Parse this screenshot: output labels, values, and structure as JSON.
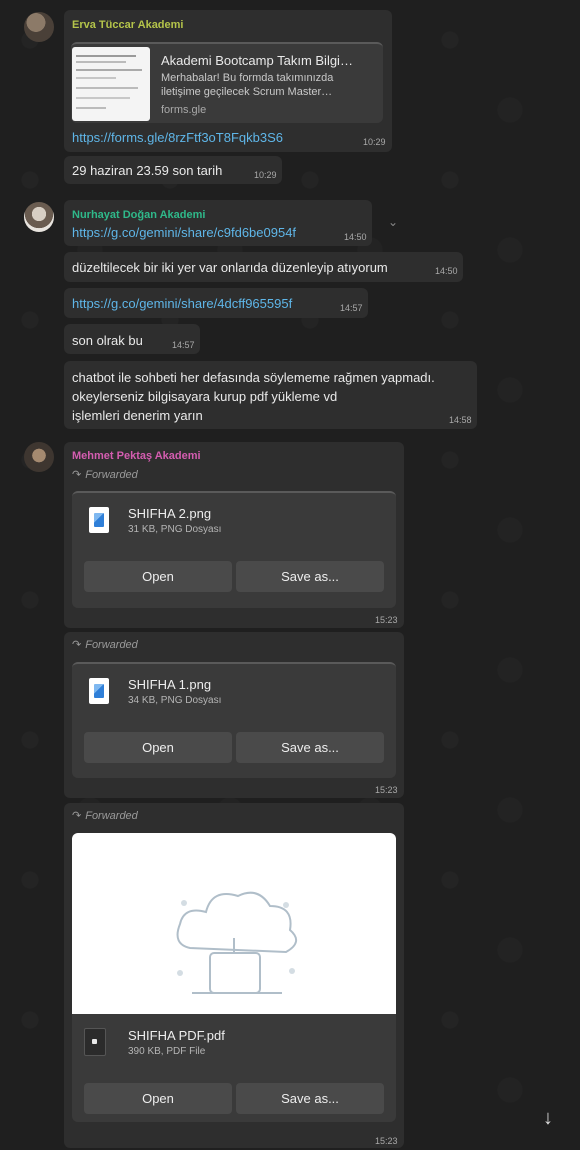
{
  "chat": {
    "group1": {
      "sender": "Erva Tüccar Akademi",
      "sender_color": "#b4c44a",
      "link_preview": {
        "title": "Akademi Bootcamp Takım Bilgi…",
        "desc_line1": "Merhabalar! Bu formda takımınızda",
        "desc_line2": "iletişime geçilecek Scrum Master…",
        "domain": "forms.gle"
      },
      "link": "https://forms.gle/8rzFtf3oT8Fqkb3S6",
      "time1": "10:29",
      "msg2": "29 haziran 23.59 son tarih",
      "time2": "10:29"
    },
    "group2": {
      "sender": "Nurhayat Doğan Akademi",
      "sender_color": "#2fb98a",
      "link1": "https://g.co/gemini/share/c9fd6be0954f",
      "time1": "14:50",
      "msg2": "düzeltilecek bir iki yer var onlarıda düzenleyip atıyorum",
      "time2": "14:50",
      "link3": "https://g.co/gemini/share/4dcff965595f",
      "time3": "14:57",
      "msg4": "son olrak bu",
      "time4": "14:57",
      "msg5_line1": "chatbot ile sohbeti her defasında söylememe rağmen yapmadı.",
      "msg5_line2": "okeylerseniz bilgisayara kurup pdf yükleme vd",
      "msg5_line3": "işlemleri denerim yarın",
      "time5": "14:58"
    },
    "group3": {
      "sender": "Mehmet Pektaş Akademi",
      "sender_color": "#d45db0",
      "forwarded_label": "Forwarded",
      "files": [
        {
          "name": "SHIFHA 2.png",
          "meta": "31 KB, PNG Dosyası",
          "open": "Open",
          "save": "Save as...",
          "time": "15:23"
        },
        {
          "name": "SHIFHA 1.png",
          "meta": "34 KB, PNG Dosyası",
          "open": "Open",
          "save": "Save as...",
          "time": "15:23"
        },
        {
          "name": "SHIFHA PDF.pdf",
          "meta": "390 KB, PDF File",
          "open": "Open",
          "save": "Save as...",
          "time": "15:23"
        }
      ]
    }
  },
  "icons": {
    "forward": "↷",
    "scroll_down": "↓",
    "chevron": "⌄"
  }
}
